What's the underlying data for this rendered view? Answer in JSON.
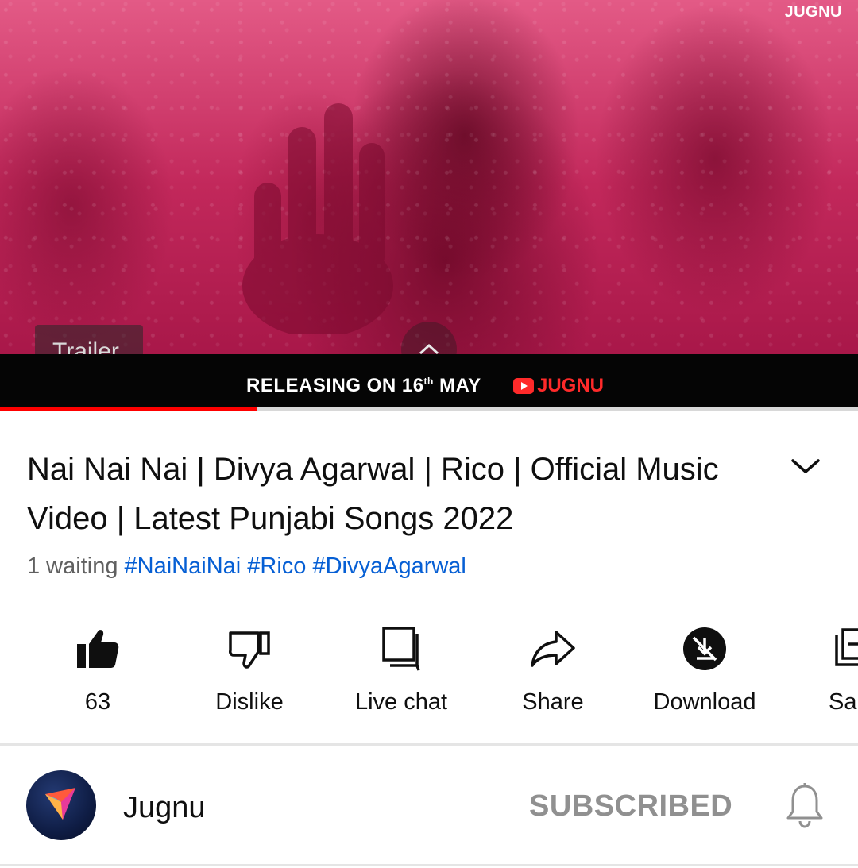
{
  "player": {
    "brand_corner": "JUGNU",
    "chip_label": "Trailer",
    "banner_text": "RELEASING ON 16",
    "banner_sup": "th",
    "banner_month": "MAY",
    "banner_brand": "JUGNU",
    "progress": 0.3
  },
  "video": {
    "title": "Nai Nai Nai | Divya Agarwal | Rico | Official Music Video | Latest Punjabi Songs 2022",
    "waiting": "1 waiting",
    "hashtags": "#NaiNaiNai #Rico #DivyaAgarwal"
  },
  "actions": [
    {
      "label": "63",
      "icon": "thumbs-up-filled-icon"
    },
    {
      "label": "Dislike",
      "icon": "thumbs-down-icon"
    },
    {
      "label": "Live chat",
      "icon": "chat-icon"
    },
    {
      "label": "Share",
      "icon": "share-arrow-icon"
    },
    {
      "label": "Download",
      "icon": "download-disabled-icon"
    },
    {
      "label": "Sa",
      "icon": "save-playlist-icon"
    }
  ],
  "channel": {
    "name": "Jugnu",
    "subscribe_label": "SUBSCRIBED"
  },
  "colors": {
    "accent_red": "#ff0000",
    "hashtag_blue": "#065fd4",
    "muted_gray": "#606060"
  }
}
